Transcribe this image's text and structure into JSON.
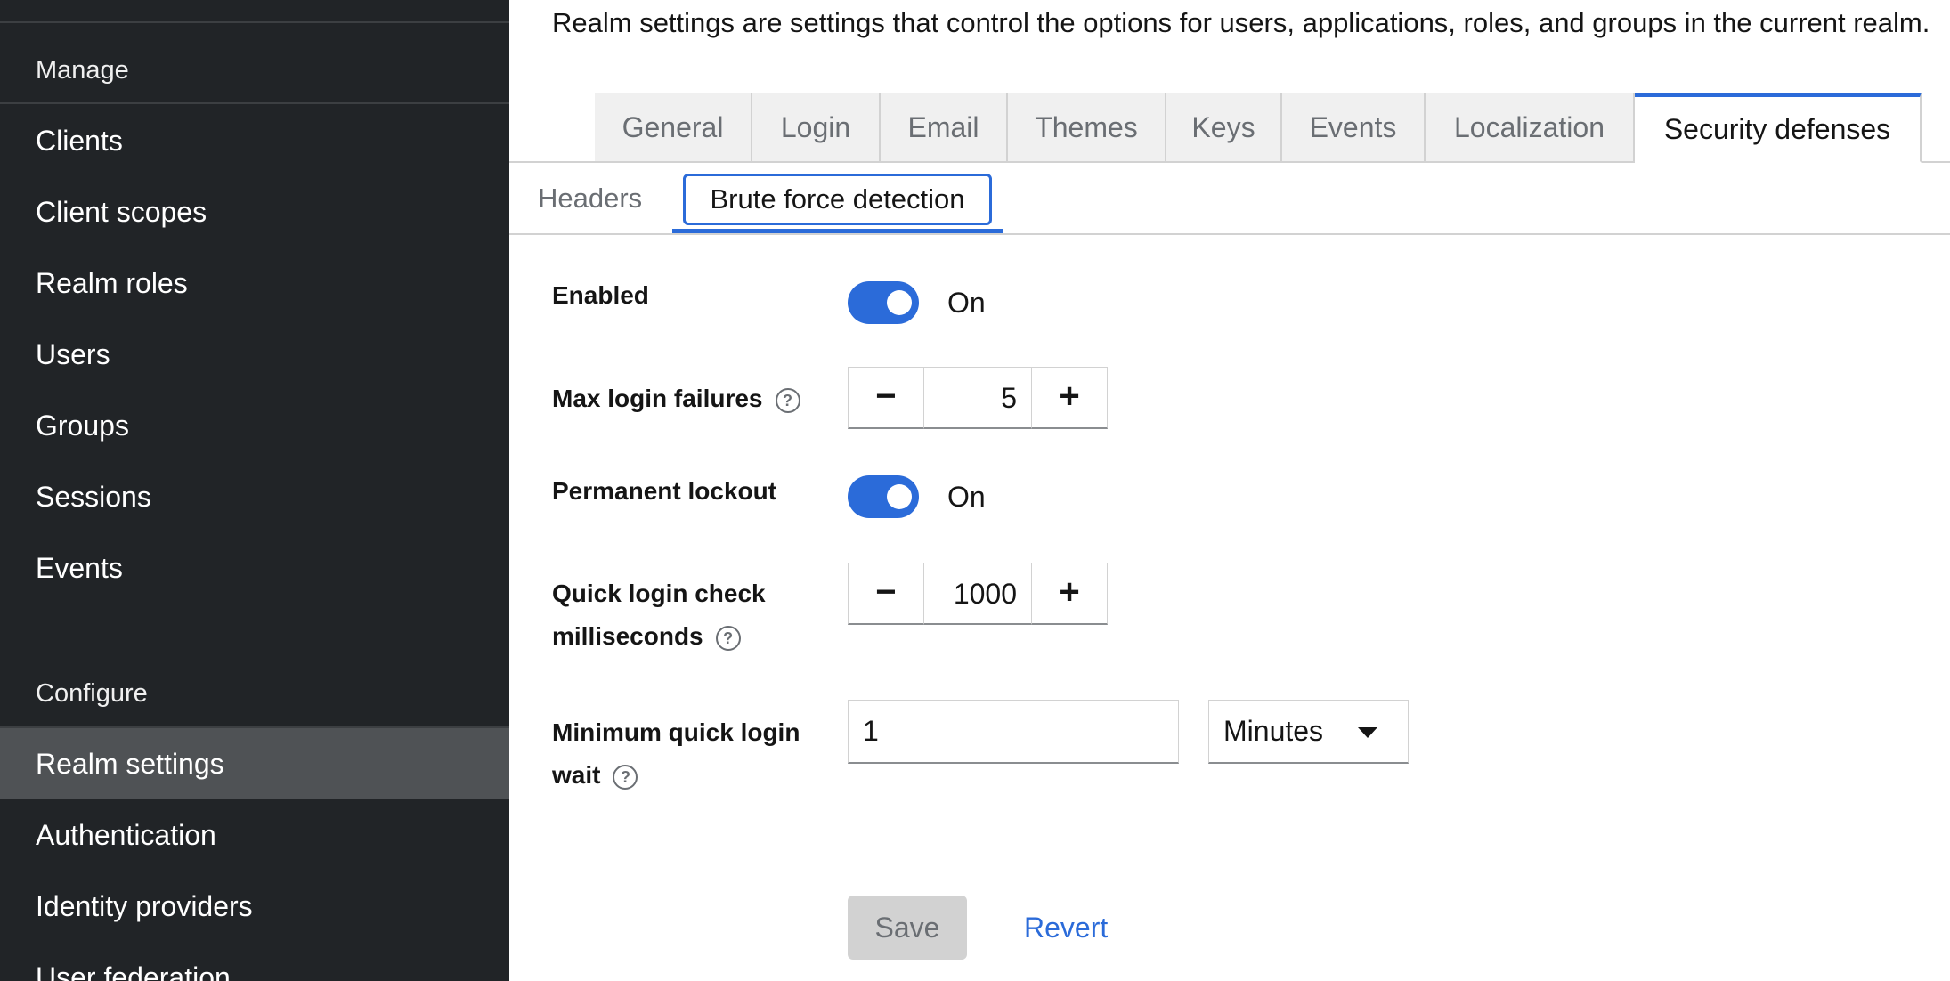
{
  "page": {
    "description": "Realm settings are settings that control the options for users, applications, roles, and groups in the current realm."
  },
  "sidebar": {
    "manage_heading": "Manage",
    "manage_items": [
      "Clients",
      "Client scopes",
      "Realm roles",
      "Users",
      "Groups",
      "Sessions",
      "Events"
    ],
    "configure_heading": "Configure",
    "configure_items": [
      "Realm settings",
      "Authentication",
      "Identity providers",
      "User federation"
    ],
    "active_item": "Realm settings"
  },
  "tabs": {
    "items": [
      "General",
      "Login",
      "Email",
      "Themes",
      "Keys",
      "Events",
      "Localization",
      "Security defenses"
    ],
    "active": "Security defenses"
  },
  "subtabs": {
    "items": [
      "Headers",
      "Brute force detection"
    ],
    "active": "Brute force detection"
  },
  "form": {
    "enabled": {
      "label": "Enabled",
      "state": "On"
    },
    "max_login_failures": {
      "label": "Max login failures",
      "value": "5"
    },
    "permanent_lockout": {
      "label": "Permanent lockout",
      "state": "On"
    },
    "quick_login_check": {
      "label_line1": "Quick login check",
      "label_line2": "milliseconds",
      "value": "1000"
    },
    "minimum_quick_login_wait": {
      "label_line1": "Minimum quick login",
      "label_line2": "wait",
      "value": "1",
      "unit": "Minutes"
    }
  },
  "actions": {
    "save": "Save",
    "revert": "Revert"
  },
  "icons": {
    "help": "help-circle-icon",
    "caret": "caret-down-icon"
  },
  "colors": {
    "accent": "#2b6bd9",
    "sidebar_bg": "#212427",
    "sidebar_active": "#4f5255"
  }
}
